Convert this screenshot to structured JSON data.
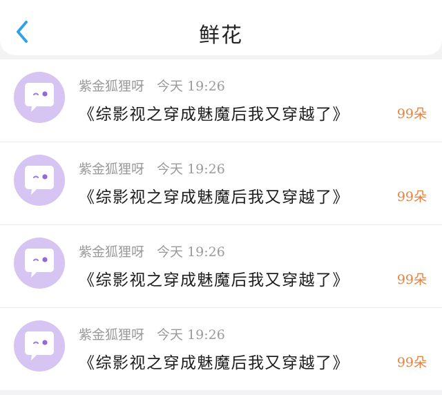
{
  "header": {
    "title": "鲜花",
    "back_icon": "chevron-left-icon",
    "accent_color": "#2ea1ea"
  },
  "records": [
    {
      "user": "紫金狐狸呀",
      "time": "今天 19:26",
      "book": "《综影视之穿成魅魔后我又穿越了》",
      "count": "99朵",
      "avatar_icon": "chat-bubble-face-icon"
    },
    {
      "user": "紫金狐狸呀",
      "time": "今天 19:26",
      "book": "《综影视之穿成魅魔后我又穿越了》",
      "count": "99朵",
      "avatar_icon": "chat-bubble-face-icon"
    },
    {
      "user": "紫金狐狸呀",
      "time": "今天 19:26",
      "book": "《综影视之穿成魅魔后我又穿越了》",
      "count": "99朵",
      "avatar_icon": "chat-bubble-face-icon"
    },
    {
      "user": "紫金狐狸呀",
      "time": "今天 19:26",
      "book": "《综影视之穿成魅魔后我又穿越了》",
      "count": "99朵",
      "avatar_icon": "chat-bubble-face-icon"
    }
  ],
  "colors": {
    "avatar_bg": "#d6c5f3",
    "count": "#e8823c"
  }
}
